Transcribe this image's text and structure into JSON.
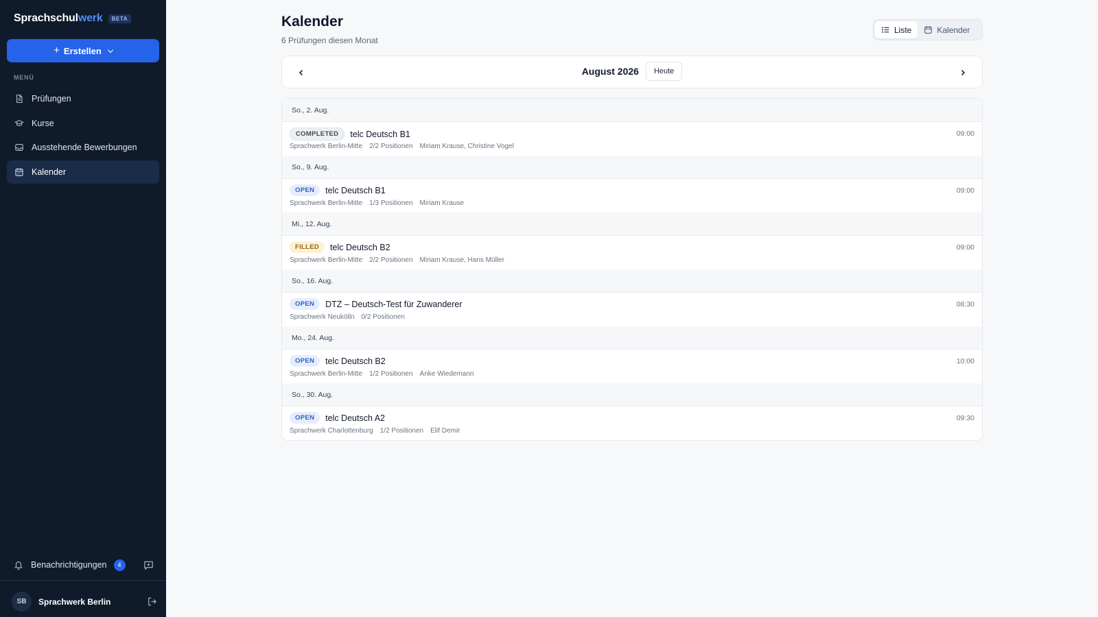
{
  "brand": {
    "name_main": "Sprachschul",
    "name_accent": "werk",
    "badge": "BETA"
  },
  "sidebar": {
    "create_label": "Erstellen",
    "menu_label": "MENÜ",
    "items": [
      {
        "label": "Prüfungen",
        "icon": "document-icon"
      },
      {
        "label": "Kurse",
        "icon": "graduation-cap-icon"
      },
      {
        "label": "Ausstehende Bewerbungen",
        "icon": "inbox-icon"
      },
      {
        "label": "Kalender",
        "icon": "calendar-icon",
        "active": true
      }
    ],
    "notifications_label": "Benachrichtigungen",
    "notifications_count": "4",
    "user_initials": "SB",
    "user_name": "Sprachwerk Berlin"
  },
  "header": {
    "title": "Kalender",
    "subtitle": "6 Prüfungen diesen Monat"
  },
  "view_toggle": {
    "list_label": "Liste",
    "calendar_label": "Kalender",
    "active": "list"
  },
  "month_nav": {
    "month": "August 2026",
    "today_label": "Heute"
  },
  "days": [
    {
      "date": "So., 2. Aug.",
      "event": {
        "status": "COMPLETED",
        "status_kind": "completed",
        "title": "telc Deutsch B1",
        "location": "Sprachwerk Berlin-Mitte",
        "positions": "2/2 Positionen",
        "people": "Miriam Krause, Christine Vogel",
        "time": "09:00"
      }
    },
    {
      "date": "So., 9. Aug.",
      "event": {
        "status": "OPEN",
        "status_kind": "open",
        "title": "telc Deutsch B1",
        "location": "Sprachwerk Berlin-Mitte",
        "positions": "1/3 Positionen",
        "people": "Miriam Krause",
        "time": "09:00"
      }
    },
    {
      "date": "Mi., 12. Aug.",
      "event": {
        "status": "FILLED",
        "status_kind": "filled",
        "title": "telc Deutsch B2",
        "location": "Sprachwerk Berlin-Mitte",
        "positions": "2/2 Positionen",
        "people": "Miriam Krause, Hans Müller",
        "time": "09:00"
      }
    },
    {
      "date": "So., 16. Aug.",
      "event": {
        "status": "OPEN",
        "status_kind": "open",
        "title": "DTZ – Deutsch-Test für Zuwanderer",
        "location": "Sprachwerk Neukölln",
        "positions": "0/2 Positionen",
        "people": "",
        "time": "08:30"
      }
    },
    {
      "date": "Mo., 24. Aug.",
      "event": {
        "status": "OPEN",
        "status_kind": "open",
        "title": "telc Deutsch B2",
        "location": "Sprachwerk Berlin-Mitte",
        "positions": "1/2 Positionen",
        "people": "Anke Wiedemann",
        "time": "10:00"
      }
    },
    {
      "date": "So., 30. Aug.",
      "event": {
        "status": "OPEN",
        "status_kind": "open",
        "title": "telc Deutsch A2",
        "location": "Sprachwerk Charlottenburg",
        "positions": "1/2 Positionen",
        "people": "Elif Demir",
        "time": "09:30"
      }
    }
  ],
  "colors": {
    "sidebar_bg": "#0f1a2b",
    "accent": "#2563eb",
    "page_bg": "#f7f8fa"
  }
}
